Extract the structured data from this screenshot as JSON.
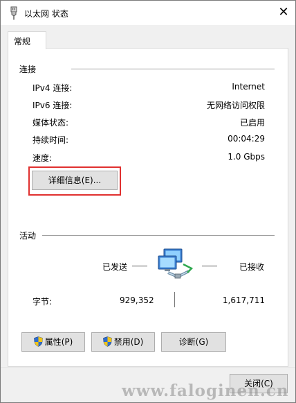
{
  "window": {
    "title": "以太网 状态"
  },
  "tabs": [
    {
      "label": "常规"
    }
  ],
  "connection": {
    "section_label": "连接",
    "rows": [
      {
        "label": "IPv4 连接:",
        "value": "Internet"
      },
      {
        "label": "IPv6 连接:",
        "value": "无网络访问权限"
      },
      {
        "label": "媒体状态:",
        "value": "已启用"
      },
      {
        "label": "持续时间:",
        "value": "00:04:29"
      },
      {
        "label": "速度:",
        "value": "1.0 Gbps"
      }
    ],
    "details_button": "详细信息(E)..."
  },
  "activity": {
    "section_label": "活动",
    "sent_label": "已发送",
    "received_label": "已接收",
    "bytes_label": "字节:",
    "bytes_sent": "929,352",
    "bytes_received": "1,617,711"
  },
  "buttons": {
    "properties": "属性(P)",
    "disable": "禁用(D)",
    "diagnose": "诊断(G)",
    "close": "关闭(C)"
  },
  "watermark": "www.faloginen.cn",
  "icons": {
    "title": "network-cable-icon",
    "activity": "network-computers-icon",
    "uac": "uac-shield-icon"
  },
  "colors": {
    "highlight_border": "#e0302f",
    "button_face": "#e1e1e1",
    "panel_bg": "#ffffff",
    "window_bg": "#f0f0f0"
  }
}
